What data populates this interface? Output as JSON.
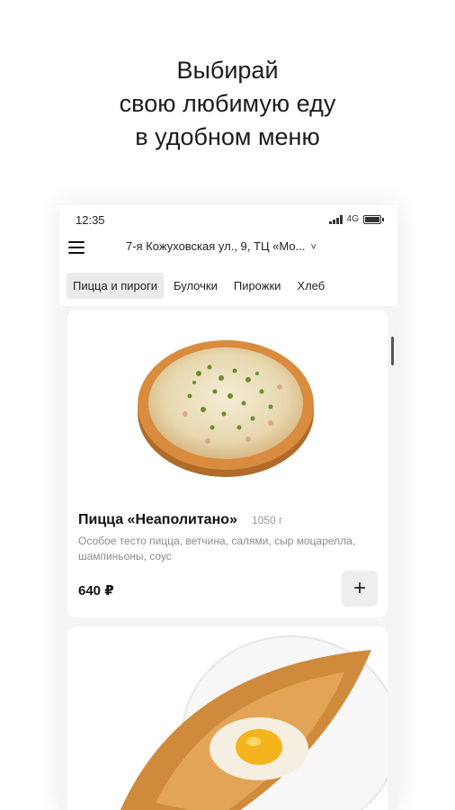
{
  "promo": {
    "line1": "Выбирай",
    "line2": "свою любимую еду",
    "line3": "в удобном меню"
  },
  "status_bar": {
    "time": "12:35",
    "network": "4G",
    "icons": [
      "signal-icon",
      "battery-icon"
    ]
  },
  "header": {
    "menu_icon": "hamburger-menu-icon",
    "address": "7-я Кожуховская ул., 9, ТЦ «Мо...",
    "chevron": "˅"
  },
  "tabs": [
    {
      "label": "Пицца и пироги",
      "active": true
    },
    {
      "label": "Булочки",
      "active": false
    },
    {
      "label": "Пирожки",
      "active": false
    },
    {
      "label": "Хлеб",
      "active": false
    }
  ],
  "products": [
    {
      "title": "Пицца «Неаполитано»",
      "weight": "1050 г",
      "description": "Особое тесто пицца, ветчина, салями, сыр моцарелла, шампиньоны, соус",
      "price": "640 ₽",
      "add_label": "+",
      "image": "pizza-image"
    },
    {
      "image": "khachapuri-image"
    }
  ],
  "colors": {
    "background": "#ffffff",
    "phone_bg": "#f4f4f4",
    "active_tab": "#ebebeb",
    "muted_text": "#8c8c8c"
  }
}
